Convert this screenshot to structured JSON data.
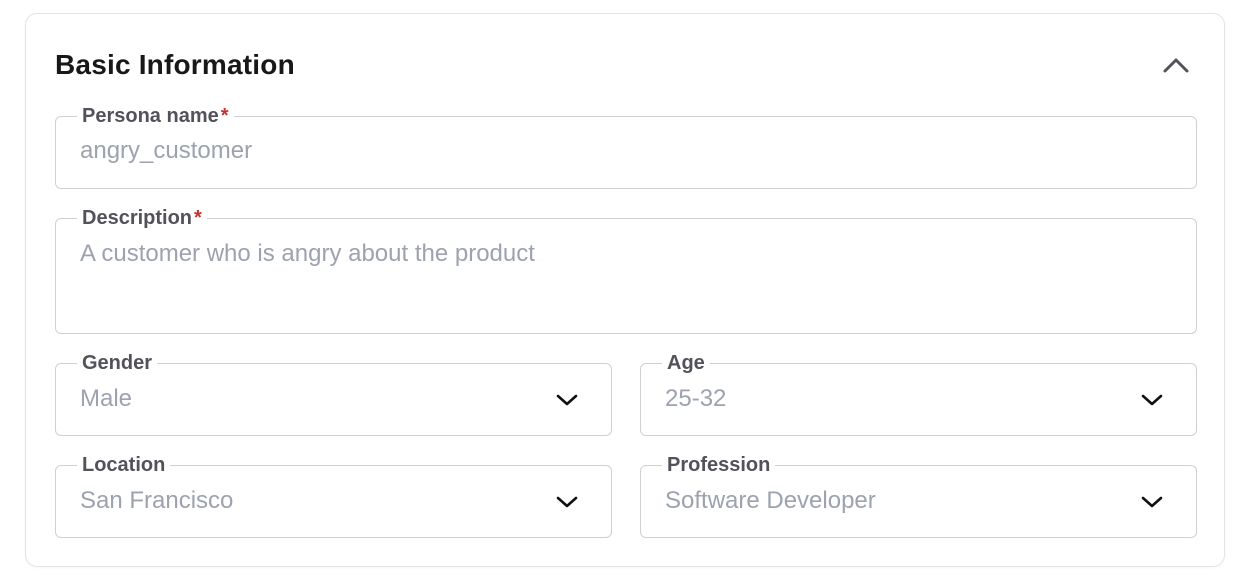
{
  "section": {
    "title": "Basic Information",
    "collapse_icon": "chevron-up-icon"
  },
  "fields": {
    "persona_name": {
      "label": "Persona name",
      "required_mark": "*",
      "value": "angry_customer"
    },
    "description": {
      "label": "Description",
      "required_mark": "*",
      "value": "A customer who is angry about the product"
    },
    "gender": {
      "label": "Gender",
      "value": "Male",
      "icon": "chevron-down-icon"
    },
    "age": {
      "label": "Age",
      "value": "25-32",
      "icon": "chevron-down-icon"
    },
    "location": {
      "label": "Location",
      "value": "San Francisco",
      "icon": "chevron-down-icon"
    },
    "profession": {
      "label": "Profession",
      "value": "Software Developer",
      "icon": "chevron-down-icon"
    }
  },
  "colors": {
    "required": "#c53030",
    "border": "#cfd0d4",
    "value_text": "#9ca3af",
    "label_text": "#52525b",
    "title_text": "#18181b"
  }
}
